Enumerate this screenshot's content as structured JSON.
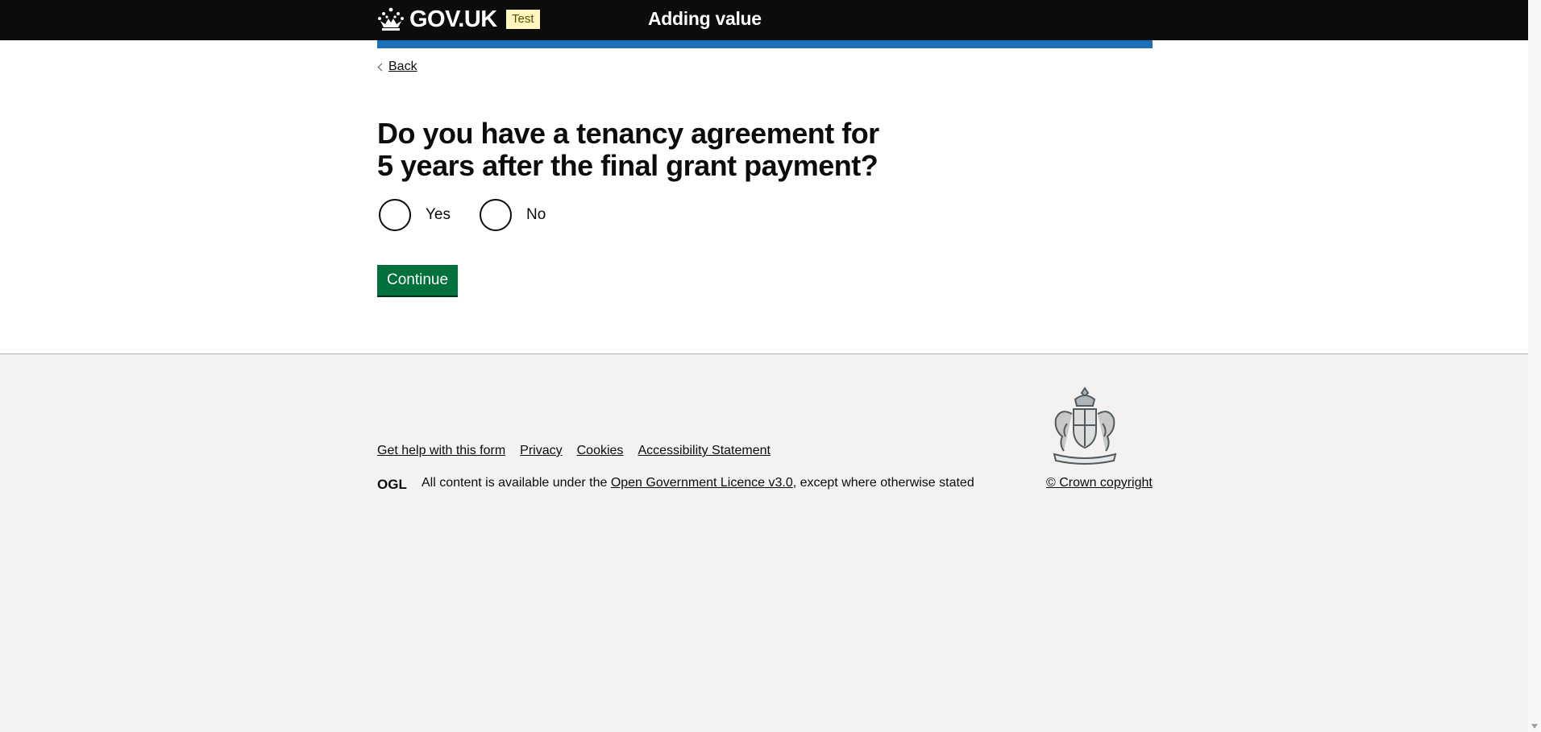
{
  "header": {
    "logo_text": "GOV.UK",
    "phase_tag": "Test",
    "service_name": "Adding value"
  },
  "main": {
    "back_label": "Back",
    "question": "Do you have a tenancy agreement for 5 years after the final grant payment?",
    "options": [
      {
        "label": "Yes",
        "selected": false
      },
      {
        "label": "No",
        "selected": false
      }
    ],
    "continue_label": "Continue"
  },
  "footer": {
    "links": [
      "Get help with this form",
      "Privacy",
      "Cookies",
      "Accessibility Statement"
    ],
    "ogl_logo_text": "OGL",
    "licence_prefix": "All content is available under the ",
    "licence_link": "Open Government Licence v3.0",
    "licence_suffix": ", except where otherwise stated",
    "copyright": "© Crown copyright"
  },
  "colors": {
    "header_bg": "#0b0c0c",
    "accent_blue": "#1d70b8",
    "button_green": "#00703c",
    "tag_yellow": "#fff7bf",
    "footer_bg": "#f3f2f1"
  }
}
